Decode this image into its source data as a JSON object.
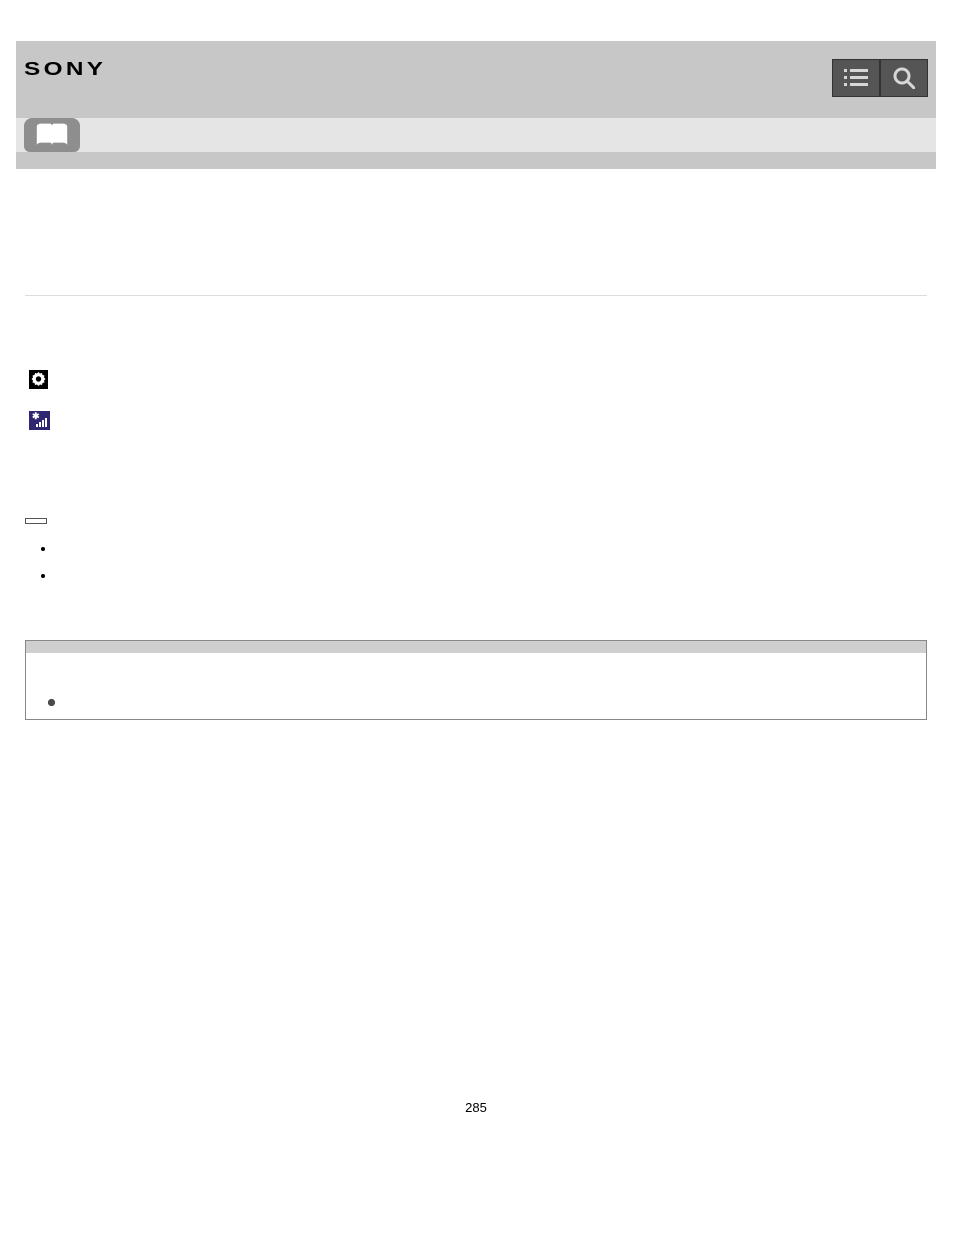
{
  "brand": "SONY",
  "page_number": "285",
  "guide_label": "",
  "step1": {
    "prefix": "",
    "setup_label": "",
    "tail": ""
  },
  "step2": {
    "prefix": "",
    "resolve_label": "",
    "tail": ""
  },
  "hint": {
    "heading": " ",
    "items": [
      "",
      ""
    ]
  },
  "note": {
    "heading": " ",
    "items": [
      "",
      "",
      ""
    ]
  }
}
